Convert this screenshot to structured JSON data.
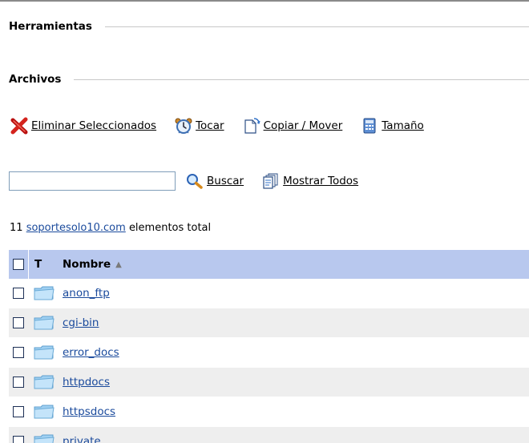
{
  "sections": {
    "tools_heading": "Herramientas",
    "files_heading": "Archivos"
  },
  "toolbar": {
    "delete_label": "Eliminar Seleccionados",
    "touch_label": "Tocar",
    "copy_move_label": "Copiar / Mover",
    "size_label": "Tamaño"
  },
  "search": {
    "value": "",
    "search_label": "Buscar",
    "show_all_label": "Mostrar Todos"
  },
  "summary": {
    "count": "11",
    "domain": "soportesolo10.com",
    "suffix": "elementos total"
  },
  "table": {
    "type_header": "T",
    "name_header": "Nombre",
    "sort_indicator": "▲",
    "rows": [
      {
        "name": "anon_ftp",
        "icon": "folder-icon"
      },
      {
        "name": "cgi-bin",
        "icon": "folder-icon"
      },
      {
        "name": "error_docs",
        "icon": "folder-icon"
      },
      {
        "name": "httpdocs",
        "icon": "folder-icon"
      },
      {
        "name": "httpsdocs",
        "icon": "folder-icon"
      },
      {
        "name": "private",
        "icon": "folder-icon"
      }
    ]
  },
  "colors": {
    "header_bg": "#b8c8ee",
    "link": "#1a4a9c",
    "row_alt": "#eeeeee"
  }
}
